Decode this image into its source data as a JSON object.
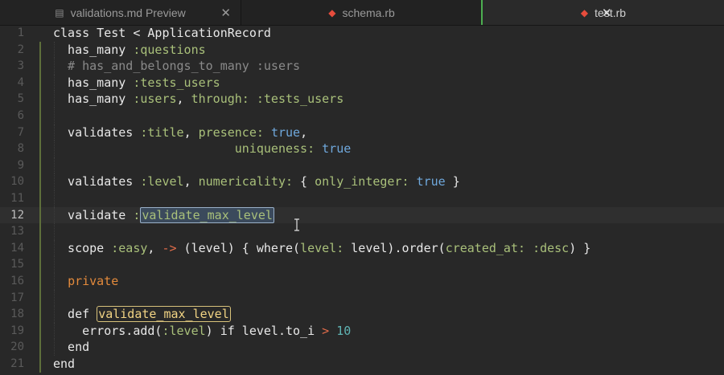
{
  "tabs": [
    {
      "label": "validations.md Preview",
      "icon": "markdown-file-icon",
      "active": false,
      "closable": true
    },
    {
      "label": "schema.rb",
      "icon": "ruby-gem-icon",
      "active": false,
      "closable": false
    },
    {
      "label": "test.rb",
      "icon": "ruby-gem-icon",
      "active": true,
      "closable": true
    }
  ],
  "editor": {
    "current_line": 12,
    "lines": [
      {
        "n": "1",
        "t": [
          [
            "kw",
            "class Test < ApplicationRecord"
          ]
        ]
      },
      {
        "n": "2",
        "t": [
          [
            "kw",
            "  has_many "
          ],
          [
            "sym",
            ":questions"
          ]
        ]
      },
      {
        "n": "3",
        "t": [
          [
            "cm",
            "  # has_and_belongs_to_many :users"
          ]
        ]
      },
      {
        "n": "4",
        "t": [
          [
            "kw",
            "  has_many "
          ],
          [
            "sym",
            ":tests_users"
          ]
        ]
      },
      {
        "n": "5",
        "t": [
          [
            "kw",
            "  has_many "
          ],
          [
            "sym",
            ":users"
          ],
          [
            "kw",
            ", "
          ],
          [
            "sym",
            "through:"
          ],
          [
            "kw",
            " "
          ],
          [
            "sym",
            ":tests_users"
          ]
        ]
      },
      {
        "n": "6",
        "t": []
      },
      {
        "n": "7",
        "t": [
          [
            "kw",
            "  validates "
          ],
          [
            "sym",
            ":title"
          ],
          [
            "kw",
            ", "
          ],
          [
            "sym",
            "presence:"
          ],
          [
            "kw",
            " "
          ],
          [
            "bool",
            "true"
          ],
          [
            "kw",
            ","
          ]
        ]
      },
      {
        "n": "8",
        "t": [
          [
            "kw",
            "                         "
          ],
          [
            "sym",
            "uniqueness:"
          ],
          [
            "kw",
            " "
          ],
          [
            "bool",
            "true"
          ]
        ]
      },
      {
        "n": "9",
        "t": []
      },
      {
        "n": "10",
        "t": [
          [
            "kw",
            "  validates "
          ],
          [
            "sym",
            ":level"
          ],
          [
            "kw",
            ", "
          ],
          [
            "sym",
            "numericality:"
          ],
          [
            "kw",
            " { "
          ],
          [
            "sym",
            "only_integer:"
          ],
          [
            "kw",
            " "
          ],
          [
            "bool",
            "true"
          ],
          [
            "kw",
            " }"
          ]
        ]
      },
      {
        "n": "11",
        "t": []
      },
      {
        "n": "12",
        "t": [
          [
            "kw",
            "  validate "
          ],
          [
            "sym",
            ":"
          ],
          [
            "sel",
            "validate_max_level"
          ]
        ]
      },
      {
        "n": "13",
        "t": []
      },
      {
        "n": "14",
        "t": [
          [
            "kw",
            "  scope "
          ],
          [
            "sym",
            ":easy"
          ],
          [
            "kw",
            ", "
          ],
          [
            "op",
            "->"
          ],
          [
            "kw",
            " (level) { where("
          ],
          [
            "sym",
            "level:"
          ],
          [
            "kw",
            " level).order("
          ],
          [
            "sym",
            "created_at:"
          ],
          [
            "kw",
            " "
          ],
          [
            "sym",
            ":desc"
          ],
          [
            "kw",
            ") }"
          ]
        ]
      },
      {
        "n": "15",
        "t": []
      },
      {
        "n": "16",
        "t": [
          [
            "kw",
            "  "
          ],
          [
            "pr",
            "private"
          ]
        ]
      },
      {
        "n": "17",
        "t": []
      },
      {
        "n": "18",
        "t": [
          [
            "kw",
            "  def "
          ],
          [
            "hl",
            "validate_max_level"
          ]
        ]
      },
      {
        "n": "19",
        "t": [
          [
            "kw",
            "    errors.add("
          ],
          [
            "sym",
            ":level"
          ],
          [
            "kw",
            ") if level.to_i "
          ],
          [
            "op",
            ">"
          ],
          [
            "kw",
            " "
          ],
          [
            "num",
            "10"
          ]
        ]
      },
      {
        "n": "20",
        "t": [
          [
            "kw",
            "  end"
          ]
        ]
      },
      {
        "n": "21",
        "t": [
          [
            "kw",
            "end"
          ]
        ]
      }
    ]
  },
  "colors": {
    "background": "#282828",
    "symbol": "#a9c07a",
    "boolean": "#6fa8dc",
    "number": "#5fb3b3",
    "operator": "#e06c4a",
    "private": "#e38a3c",
    "comment": "#8a8a8a",
    "tab_active_indicator": "#4caf50"
  }
}
